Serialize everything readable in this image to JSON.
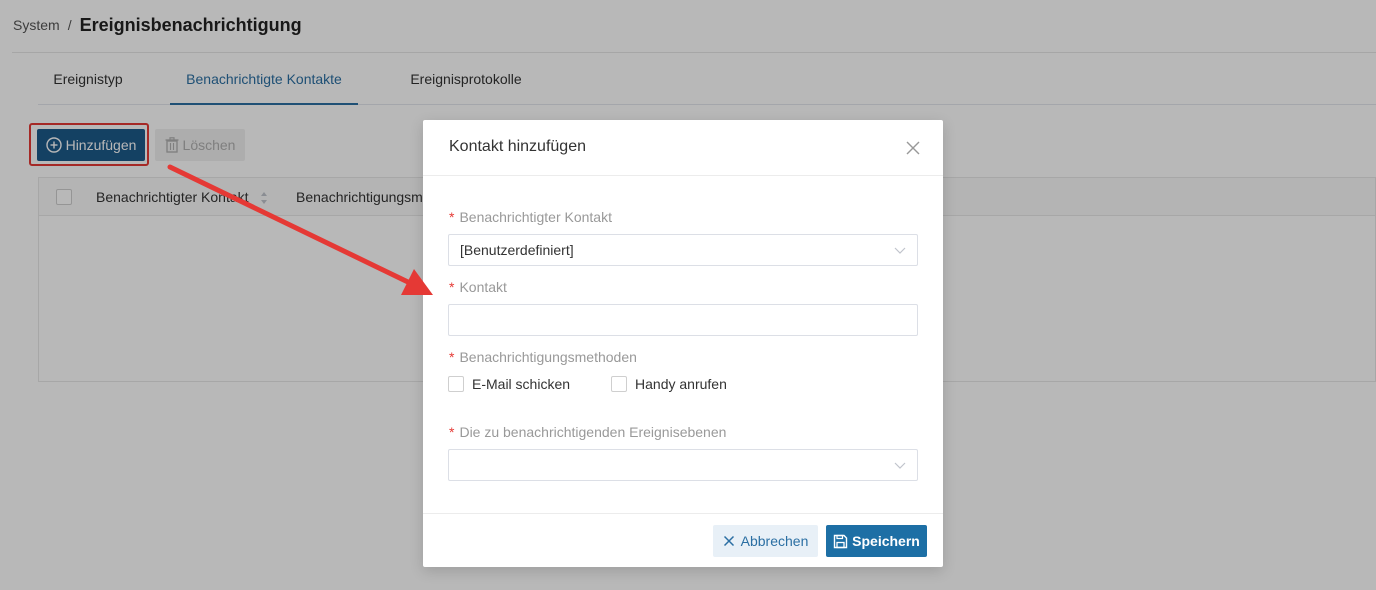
{
  "breadcrumb": {
    "root": "System",
    "separator": "/",
    "title": "Ereignisbenachrichtigung"
  },
  "tabs": [
    {
      "label": "Ereignistyp",
      "active": false
    },
    {
      "label": "Benachrichtigte Kontakte",
      "active": true
    },
    {
      "label": "Ereignisprotokolle",
      "active": false
    }
  ],
  "toolbar": {
    "add_label": "Hinzufügen",
    "delete_label": "Löschen"
  },
  "table": {
    "columns": [
      "Benachrichtigter Kontakt",
      "Benachrichtigungsm"
    ]
  },
  "modal": {
    "title": "Kontakt hinzufügen",
    "fields": {
      "contact_type": {
        "label": "Benachrichtigter Kontakt",
        "value": "[Benutzerdefiniert]"
      },
      "contact": {
        "label": "Kontakt",
        "value": ""
      },
      "methods": {
        "label": "Benachrichtigungsmethoden",
        "options": [
          {
            "label": "E-Mail schicken",
            "checked": false
          },
          {
            "label": "Handy anrufen",
            "checked": false
          }
        ]
      },
      "levels": {
        "label": "Die zu benachrichtigenden Ereignisebenen",
        "value": ""
      }
    },
    "required_mark": "*",
    "cancel_label": "Abbrechen",
    "save_label": "Speichern"
  },
  "colors": {
    "primary": "#1d5a8a",
    "accent": "#2b6fa3",
    "required": "#e53935",
    "annotation": "#e53935"
  }
}
